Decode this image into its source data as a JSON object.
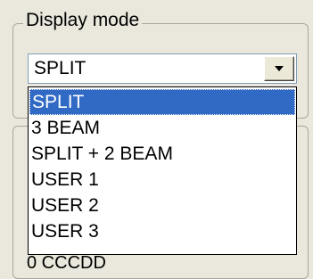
{
  "group": {
    "title": "Display mode"
  },
  "combo": {
    "value": "SPLIT",
    "arrow_icon": "chevron-down-icon"
  },
  "dropdown": {
    "options": [
      "SPLIT",
      "3 BEAM",
      "SPLIT + 2 BEAM",
      "USER 1",
      "USER 2",
      "USER 3"
    ],
    "selected_index": 0
  },
  "below_group": {
    "partial_text": "0 CCCDD"
  },
  "colors": {
    "selection": "#316ac5",
    "window_bg": "#eae8dc"
  }
}
